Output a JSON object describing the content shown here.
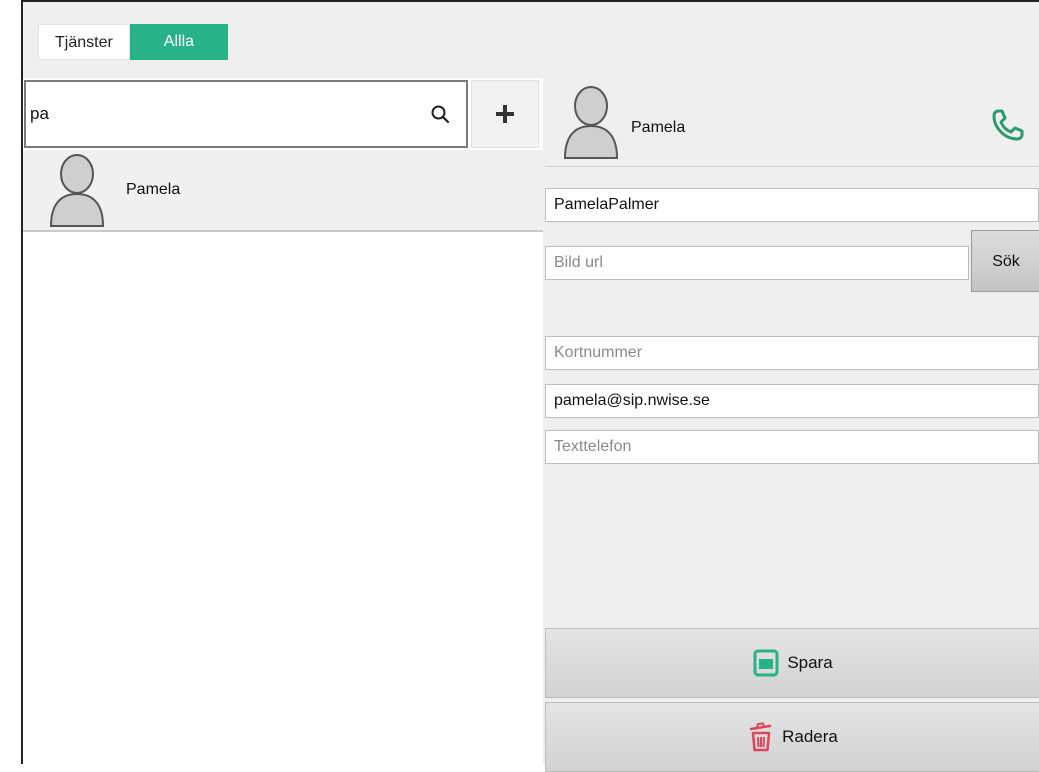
{
  "tabs": [
    {
      "label": "Tjänster",
      "active": false
    },
    {
      "label": "Allla",
      "active": true
    }
  ],
  "search": {
    "value": "pa",
    "icon": "search-icon"
  },
  "add_button": {
    "icon": "plus-icon"
  },
  "contacts": [
    {
      "name": "Pamela",
      "icon": "user-avatar-icon"
    }
  ],
  "detail": {
    "name": "Pamela",
    "call_icon": "phone-icon",
    "display_name": "PamelaPalmer",
    "image_url_placeholder": "Bild url",
    "search_label": "Sök",
    "short_number_placeholder": "Kortnummer",
    "sip_address": "pamela@sip.nwise.se",
    "text_phone_placeholder": "Texttelefon",
    "save_label": "Spara",
    "delete_label": "Radera"
  },
  "colors": {
    "accent": "#27b287",
    "save_icon": "#27b287",
    "delete_icon": "#e0445a",
    "phone_icon": "#2a9a6e"
  }
}
